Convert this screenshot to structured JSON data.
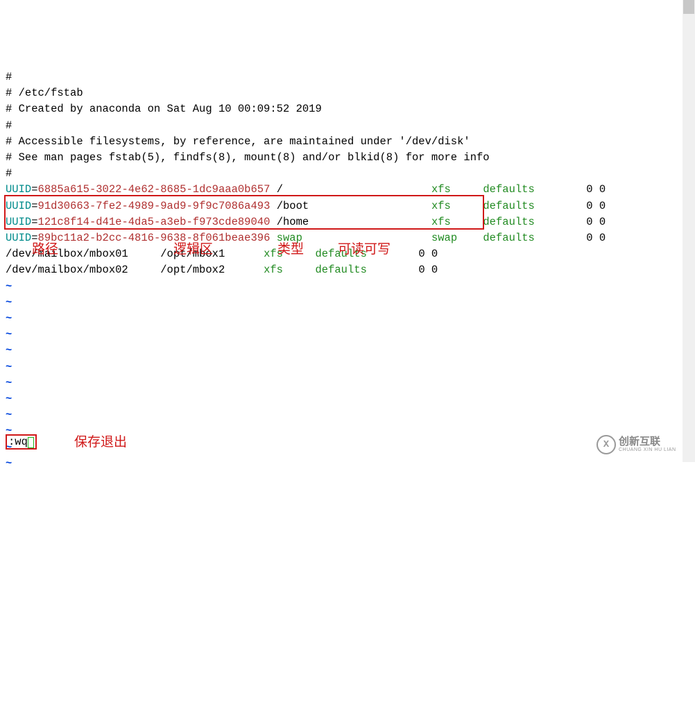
{
  "lines": [
    {
      "type": "comment",
      "text": "#"
    },
    {
      "type": "comment",
      "text": "# /etc/fstab"
    },
    {
      "type": "comment",
      "text": "# Created by anaconda on Sat Aug 10 00:09:52 2019"
    },
    {
      "type": "comment",
      "text": "#"
    },
    {
      "type": "comment",
      "text": "# Accessible filesystems, by reference, are maintained under '/dev/disk'"
    },
    {
      "type": "comment",
      "text": "# See man pages fstab(5), findfs(8), mount(8) and/or blkid(8) for more info"
    },
    {
      "type": "comment",
      "text": "#"
    }
  ],
  "uuid_entries": [
    {
      "eq": "=",
      "uuid": "6885a615-3022-4e62-8685-1dc9aaa0b657",
      "mount": " /                       ",
      "fstype": "xfs    ",
      "opts": " defaults        ",
      "dump": "0",
      "pass": " 0"
    },
    {
      "eq": "=",
      "uuid": "91d30663-7fe2-4989-9ad9-9f9c7086a493",
      "mount": " /boot                   ",
      "fstype": "xfs    ",
      "opts": " defaults        ",
      "dump": "0",
      "pass": " 0"
    },
    {
      "eq": "=",
      "uuid": "121c8f14-d41e-4da5-a3eb-f973cde89040",
      "mount": " /home                   ",
      "fstype": "xfs    ",
      "opts": " defaults        ",
      "dump": "0",
      "pass": " 0"
    },
    {
      "eq": "=",
      "uuid": "89bc11a2-b2cc-4816-9638-8f061beae396",
      "mount": " ",
      "mg": "swap",
      "pad": "                    ",
      "fstype": "swap   ",
      "opts": " defaults        ",
      "dump": "0",
      "pass": " 0"
    }
  ],
  "dev_entries": [
    {
      "dev": "/dev/mailbox/mbox01     /opt/mbox1      ",
      "fstype": "xfs     defaults        ",
      "nums": "0 0"
    },
    {
      "dev": "/dev/mailbox/mbox02     /opt/mbox2      ",
      "fstype": "xfs     defaults        ",
      "nums": "0 0"
    }
  ],
  "tilde_count": 12,
  "uuid_label": "UUID",
  "annotations": {
    "a1": "路径",
    "a2": "逻辑区",
    "a3": "类型",
    "a4": "可读可写",
    "a5": "保存退出"
  },
  "wq": ":wq",
  "watermark": {
    "brand": "创新互联",
    "sub": "CHUANG XIN HU LIAN",
    "icon": "X"
  }
}
